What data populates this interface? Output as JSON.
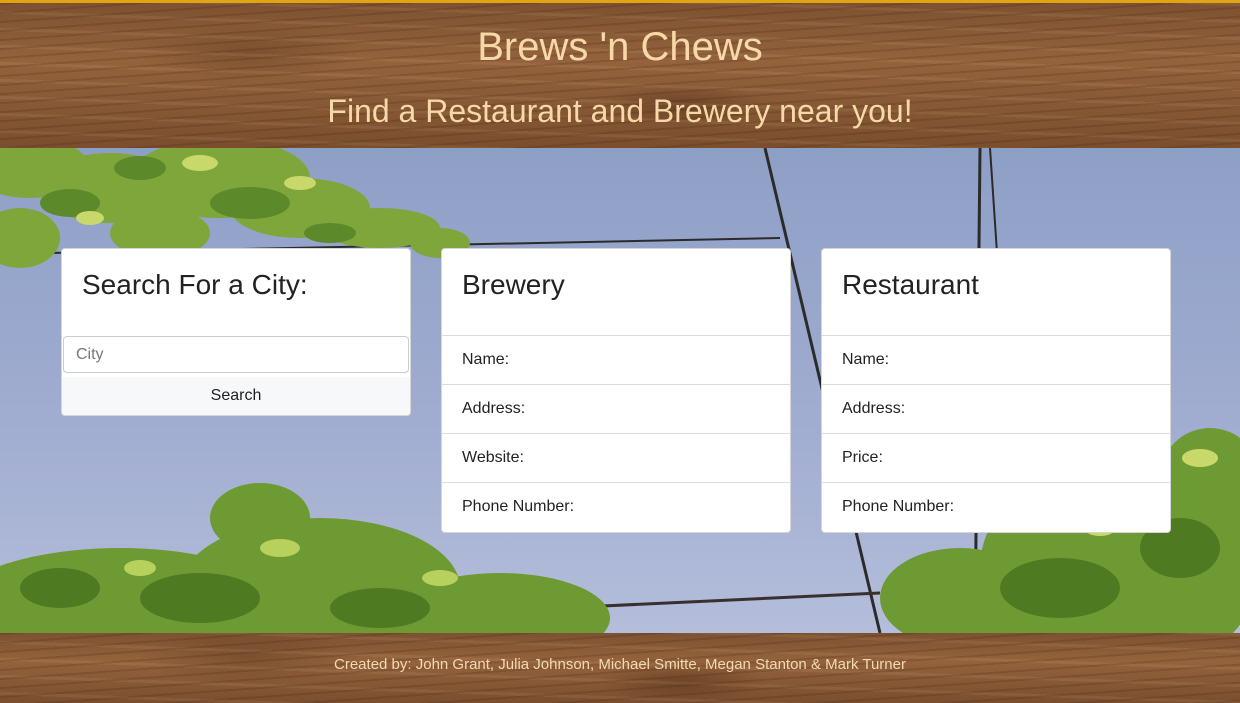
{
  "header": {
    "title": "Brews 'n Chews",
    "subtitle": "Find a Restaurant and Brewery near you!"
  },
  "search": {
    "title": "Search For a City:",
    "input_placeholder": "City",
    "input_value": "",
    "button_label": "Search"
  },
  "brewery": {
    "title": "Brewery",
    "fields": [
      "Name:",
      "Address:",
      "Website:",
      "Phone Number:"
    ]
  },
  "restaurant": {
    "title": "Restaurant",
    "fields": [
      "Name:",
      "Address:",
      "Price:",
      "Phone Number:"
    ]
  },
  "footer": {
    "credits": "Created by: John Grant, Julia Johnson, Michael Smitte, Megan Stanton & Mark Turner"
  },
  "colors": {
    "title_text": "#f7d9a8",
    "accent_border": "#e0a514",
    "sky": "#8e9fc6",
    "leaves": "#7fa63a"
  }
}
